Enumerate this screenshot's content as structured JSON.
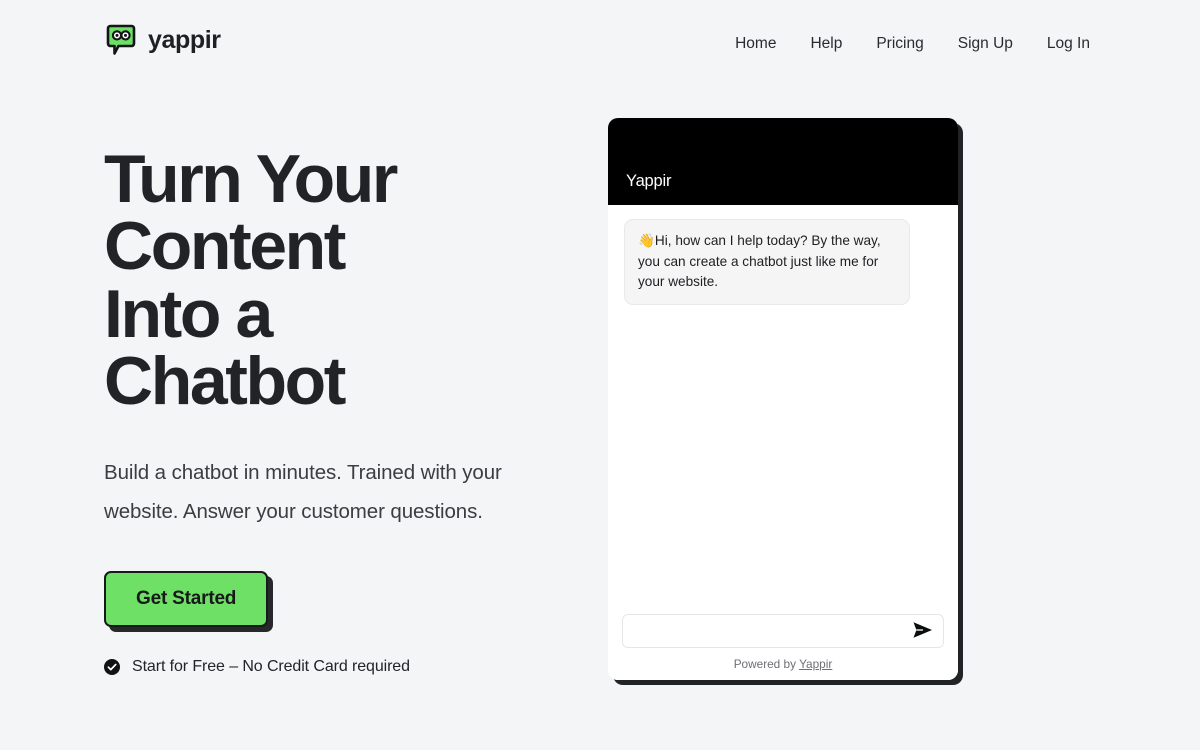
{
  "brand": {
    "name": "yappir",
    "logo_icon": "chat-bubble-face-icon",
    "logo_color": "#6ee065"
  },
  "nav": {
    "items": [
      {
        "label": "Home"
      },
      {
        "label": "Help"
      },
      {
        "label": "Pricing"
      },
      {
        "label": "Sign Up"
      },
      {
        "label": "Log In"
      }
    ]
  },
  "hero": {
    "title_lines": [
      "Turn Your",
      "Content",
      "Into a",
      "Chatbot"
    ],
    "subtitle": "Build a chatbot in minutes. Trained with your website. Answer your customer questions.",
    "cta_label": "Get Started",
    "cta_color": "#6ee065",
    "note_icon": "check-circle-icon",
    "note": "Start for Free – No Credit Card required"
  },
  "widget": {
    "header_title": "Yappir",
    "header_color": "#000000",
    "messages": [
      {
        "sender": "bot",
        "text": "👋Hi, how can I help today? By the way, you can create a chatbot just like me for your website."
      }
    ],
    "input": {
      "value": "",
      "placeholder": ""
    },
    "send_icon": "send-paper-plane-icon",
    "footer_prefix": "Powered by ",
    "footer_link": "Yappir"
  }
}
